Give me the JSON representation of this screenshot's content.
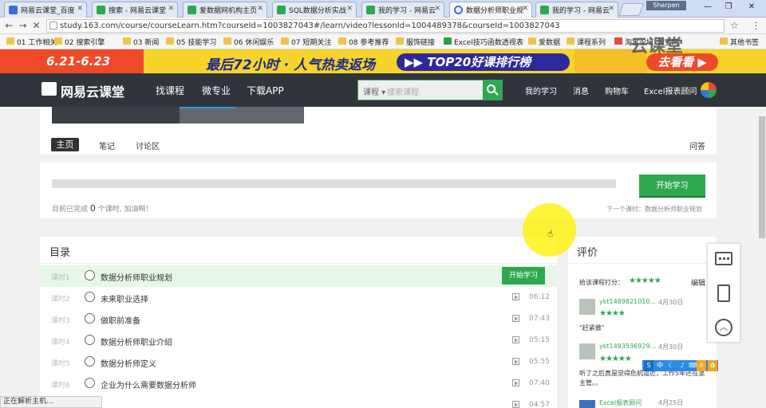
{
  "browser": {
    "tabs": [
      {
        "title": "网易云课堂_百度",
        "color": "#3a6fd8",
        "active": false
      },
      {
        "title": "搜索 - 网易云课堂",
        "color": "#2fa84f",
        "active": false
      },
      {
        "title": "爱数据网机构主页",
        "color": "#2fa84f",
        "active": false
      },
      {
        "title": "SQL数据分析实战",
        "color": "#2fa84f",
        "active": false
      },
      {
        "title": "我的学习 - 网易云",
        "color": "#2fa84f",
        "active": false
      },
      {
        "title": "数据分析师职业规",
        "color": "#3a6fd8",
        "active": true
      },
      {
        "title": "我的学习 - 网易云",
        "color": "#2fa84f",
        "active": false
      }
    ],
    "user_badge": "Sharpen",
    "window_controls": [
      "—",
      "❐",
      "✕"
    ],
    "url": "study.163.com/course/courseLearn.htm?courseId=1003827043#/learn/video?lessonId=1004489378&courseId=1003827043",
    "bookmarks": [
      "01 工作相关",
      "02 搜索引擎",
      "03 新闻",
      "05 技能学习",
      "06 休闲娱乐",
      "07 短期关注",
      "08 参考推荐",
      "服饰链接",
      "Excel技巧函数透视表",
      "爱数据",
      "课程系列",
      "淘宝论坛_淘宝网",
      "其他书签"
    ],
    "status_text": "正在解析主机..."
  },
  "banner": {
    "date": "6.21-6.23",
    "headline": "最后72小时 · 人气热卖返场",
    "pill": "▶▶ TOP20好课排行榜",
    "cta": "去看看 ▶",
    "watermark": "云课堂"
  },
  "header": {
    "logo": "网易云课堂",
    "nav": [
      "找课程",
      "微专业",
      "下载APP"
    ],
    "search_category": "课程 ▾",
    "search_placeholder": "搜索课程",
    "right_nav": [
      "我的学习",
      "消息",
      "购物车",
      "Excel报表顾问"
    ]
  },
  "course_tabs": {
    "items": [
      "主页",
      "笔记",
      "讨论区"
    ],
    "qa": "问答"
  },
  "progress": {
    "start_button": "开始学习",
    "done_prefix": "目前已完成",
    "done_count": "0",
    "done_suffix": "个课时, 加油啊！",
    "next_lesson": "下一个课时：数据分析师职业规划",
    "percent": 0
  },
  "catalog": {
    "title": "目录",
    "lessons": [
      {
        "no": "课时1",
        "title": "数据分析师职业规划",
        "duration": "",
        "button": "开始学习"
      },
      {
        "no": "课时2",
        "title": "未来职业选择",
        "duration": "06:12",
        "button": ""
      },
      {
        "no": "课时3",
        "title": "做职前准备",
        "duration": "07:43",
        "button": ""
      },
      {
        "no": "课时4",
        "title": "数据分析师职业介绍",
        "duration": "05:15",
        "button": ""
      },
      {
        "no": "课时5",
        "title": "数据分析师定义",
        "duration": "05:55",
        "button": ""
      },
      {
        "no": "课时6",
        "title": "企业为什么需要数据分析师",
        "duration": "07:40",
        "button": ""
      },
      {
        "no": "",
        "title": "",
        "duration": "04:57",
        "button": ""
      }
    ]
  },
  "reviews": {
    "title": "评价",
    "rate_label": "给该课程打分：",
    "edit": "编辑",
    "items": [
      {
        "name": "ykt1489821010...",
        "date": "4月30日",
        "stars": "★★★★",
        "text": "\"赶紧撤\""
      },
      {
        "name": "ykt1493536929...",
        "date": "4月30日",
        "stars": "★★★★★",
        "text": "听了之后真是觉得危机逼近，工作5年还在混主管。。"
      },
      {
        "name": "Excel报表顾问",
        "date": "4月25日",
        "stars": "",
        "text": ""
      }
    ]
  },
  "ime": [
    "中",
    "☾",
    "♪",
    "⌨",
    "☼",
    "✿"
  ]
}
